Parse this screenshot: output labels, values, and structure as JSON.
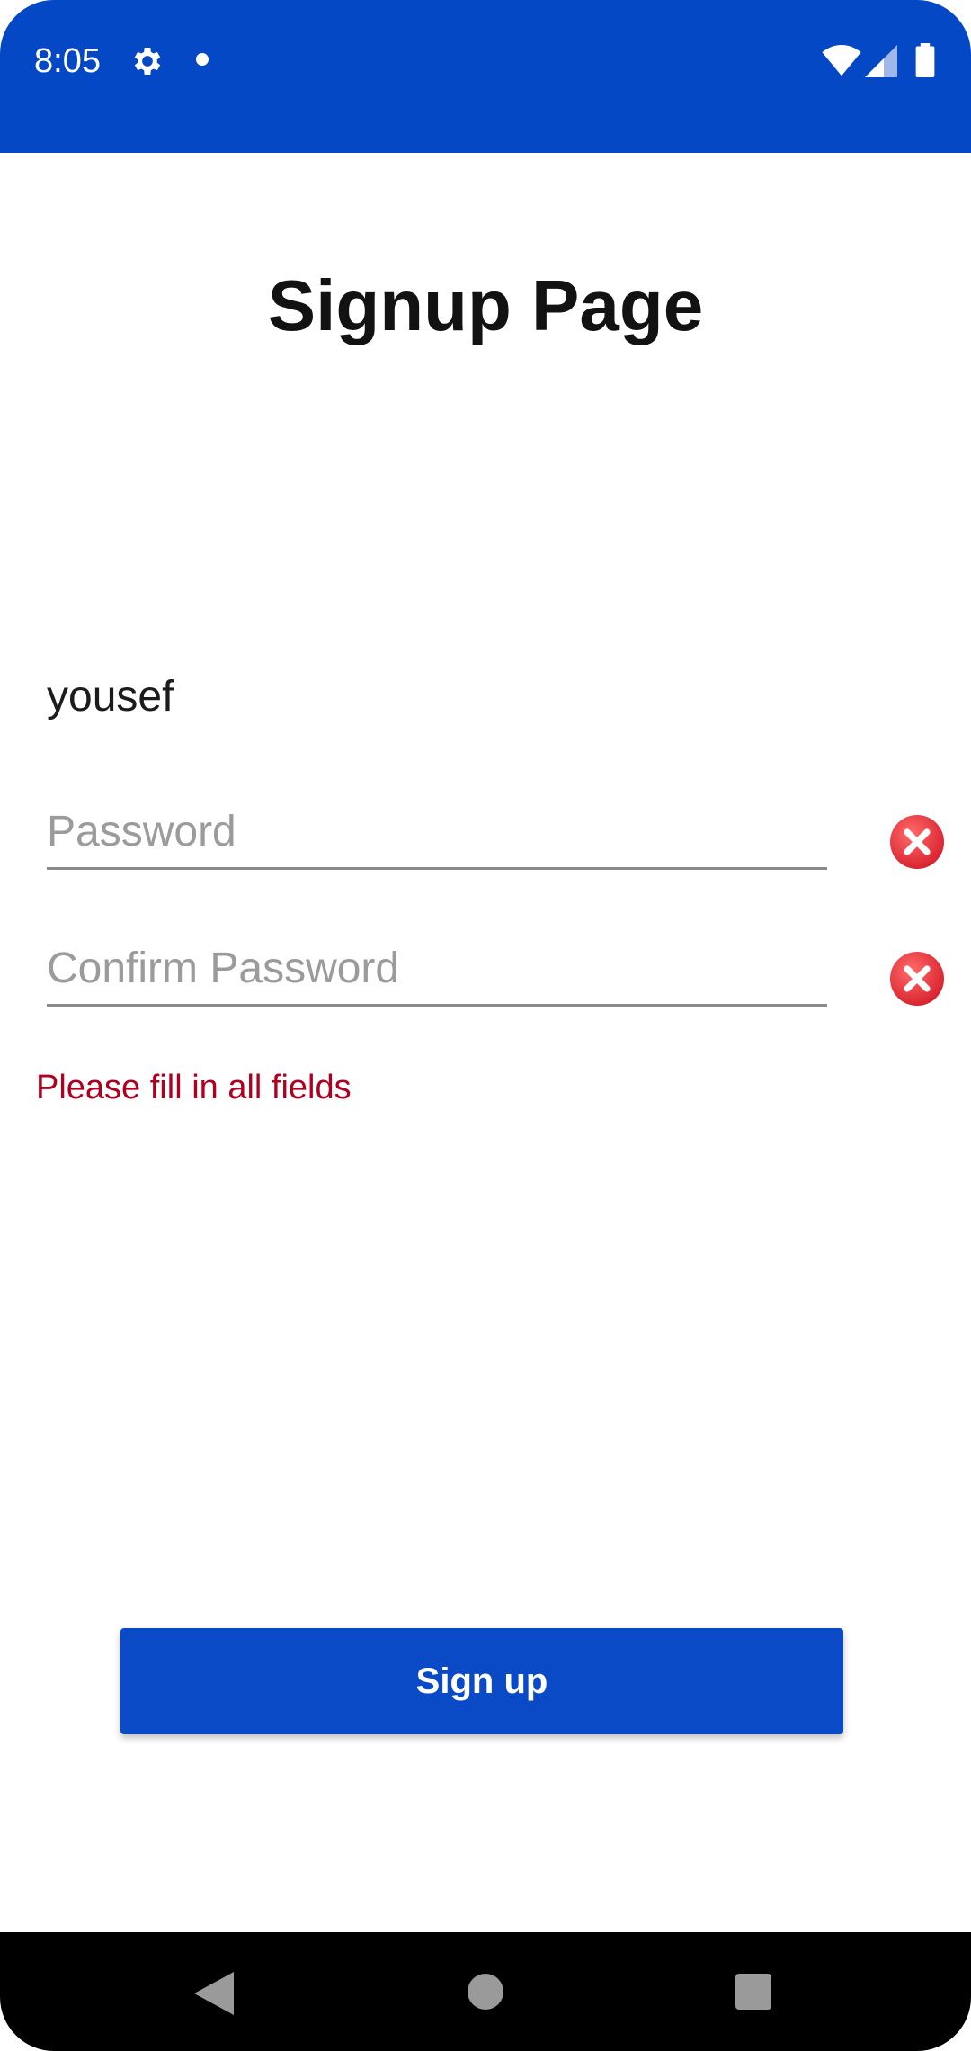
{
  "status_bar": {
    "time": "8:05",
    "icons": [
      "gear-icon",
      "notification-dot-icon",
      "wifi-icon",
      "signal-icon",
      "battery-icon"
    ],
    "background": "#0548c6"
  },
  "page": {
    "title": "Signup Page"
  },
  "form": {
    "username_value": "yousef",
    "password_placeholder": "Password",
    "password_value": "",
    "confirm_placeholder": "Confirm Password",
    "confirm_value": "",
    "error_message": "Please fill in all fields",
    "error_color": "#b00020"
  },
  "actions": {
    "signup_label": "Sign up",
    "signup_color": "#0b4ac6"
  },
  "nav_bar": {
    "icons": [
      "back-icon",
      "home-icon",
      "recents-icon"
    ]
  }
}
